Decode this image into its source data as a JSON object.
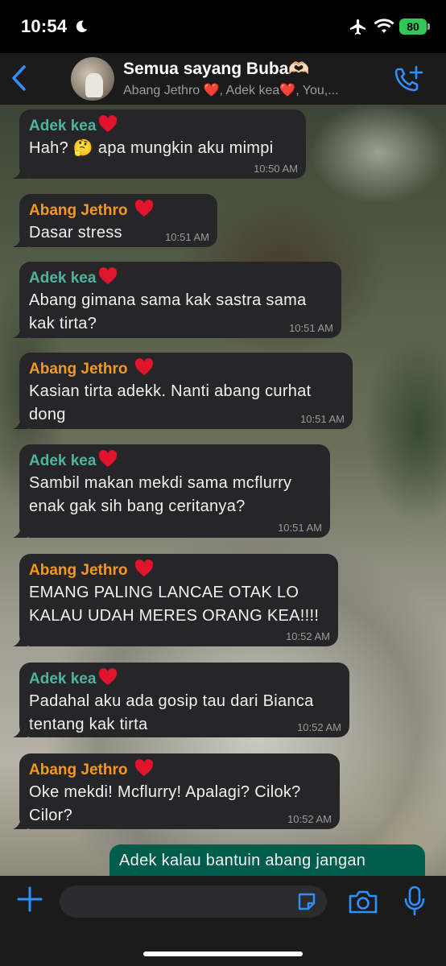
{
  "status_bar": {
    "time": "10:54",
    "battery": "80"
  },
  "header": {
    "back_icon": "chevron-left-icon",
    "title": "Semua sayang Buba🫶🏻",
    "subtitle": "Abang Jethro ❤️, Adek kea❤️, You,...",
    "call_icon": "add-call-icon"
  },
  "colors": {
    "accent": "#2e8fff",
    "incoming_bubble": "#262628",
    "outgoing_bubble": "#005c4b",
    "sender_kea": "#4fb3a0",
    "sender_jethro": "#f39a1e"
  },
  "messages": [
    {
      "sender": "Adek kea",
      "lines": [
        "Hah? 🤔 apa mungkin aku mimpi"
      ],
      "time": "10:50 AM"
    },
    {
      "sender": "Abang Jethro ",
      "lines": [
        "Dasar stress"
      ],
      "time": "10:51 AM"
    },
    {
      "sender": "Adek kea",
      "lines": [
        "Abang gimana sama kak sastra sama",
        "kak tirta?"
      ],
      "time": "10:51 AM"
    },
    {
      "sender": "Abang Jethro ",
      "lines": [
        "Kasian tirta adekk. Nanti abang curhat",
        "dong"
      ],
      "time": "10:51 AM"
    },
    {
      "sender": "Adek kea",
      "lines": [
        "Sambil makan mekdi sama mcflurry",
        "enak gak sih bang ceritanya?"
      ],
      "time": "10:51 AM"
    },
    {
      "sender": "Abang Jethro ",
      "lines": [
        "EMANG PALING LANCAE OTAK LO",
        "KALAU UDAH MERES ORANG KEA!!!!"
      ],
      "time": "10:52 AM"
    },
    {
      "sender": "Adek kea",
      "lines": [
        "Padahal aku ada gosip tau dari Bianca",
        "tentang kak tirta"
      ],
      "time": "10:52 AM"
    },
    {
      "sender": "Abang Jethro ",
      "lines": [
        "Oke mekdi! Mcflurry! Apalagi? Cilok?",
        "Cilor?"
      ],
      "time": "10:52 AM"
    },
    {
      "sender": "",
      "lines": [
        "Adek kalau bantuin abang jangan"
      ],
      "time": ""
    }
  ],
  "input_bar": {
    "plus_icon": "plus-icon",
    "sticker_icon": "sticker-icon",
    "camera_icon": "camera-icon",
    "mic_icon": "microphone-icon"
  }
}
